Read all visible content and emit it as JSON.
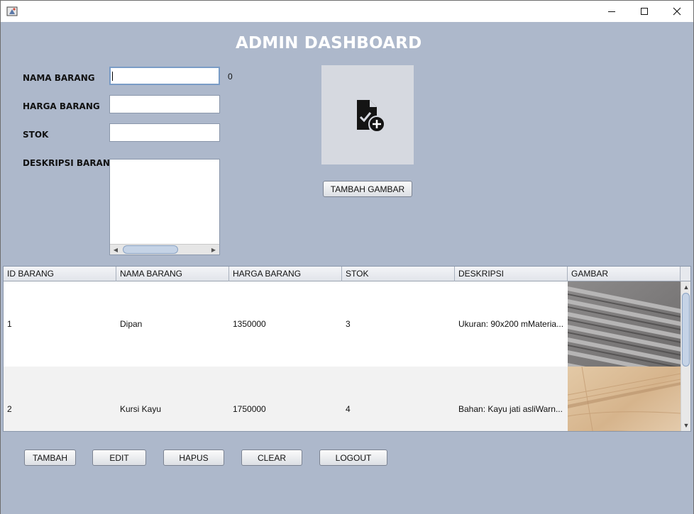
{
  "window": {
    "controls": {
      "minimize_icon": "minimize-icon",
      "maximize_icon": "maximize-icon",
      "close_icon": "close-icon"
    }
  },
  "dashboard": {
    "title": "ADMIN DASHBOARD"
  },
  "form": {
    "nama_label": "NAMA BARANG",
    "harga_label": "HARGA BARANG",
    "stok_label": "STOK",
    "deskripsi_label": "DESKRIPSI BARANG",
    "nama_value": "",
    "harga_value": "",
    "stok_value": "",
    "deskripsi_value": "",
    "counter": "0"
  },
  "image_panel": {
    "icon": "add-file-icon",
    "button_label": "TAMBAH GAMBAR"
  },
  "table": {
    "columns": [
      "ID BARANG",
      "NAMA BARANG",
      "HARGA BARANG",
      "STOK",
      "DESKRIPSI",
      "GAMBAR"
    ],
    "rows": [
      {
        "id": "1",
        "nama": "Dipan",
        "harga": "1350000",
        "stok": "3",
        "deskripsi": "Ukuran: 90x200 mMateria...",
        "gambar": "bed-slats-thumbnail"
      },
      {
        "id": "2",
        "nama": "Kursi Kayu",
        "harga": "1750000",
        "stok": "4",
        "deskripsi": "Bahan: Kayu jati asliWarn...",
        "gambar": "wood-chair-thumbnail"
      }
    ]
  },
  "actions": {
    "tambah": "TAMBAH",
    "edit": "EDIT",
    "hapus": "HAPUS",
    "clear": "CLEAR",
    "logout": "LOGOUT"
  },
  "colors": {
    "background": "#adb8cb",
    "title": "#ffffff",
    "image_box": "#d6d9e0"
  }
}
